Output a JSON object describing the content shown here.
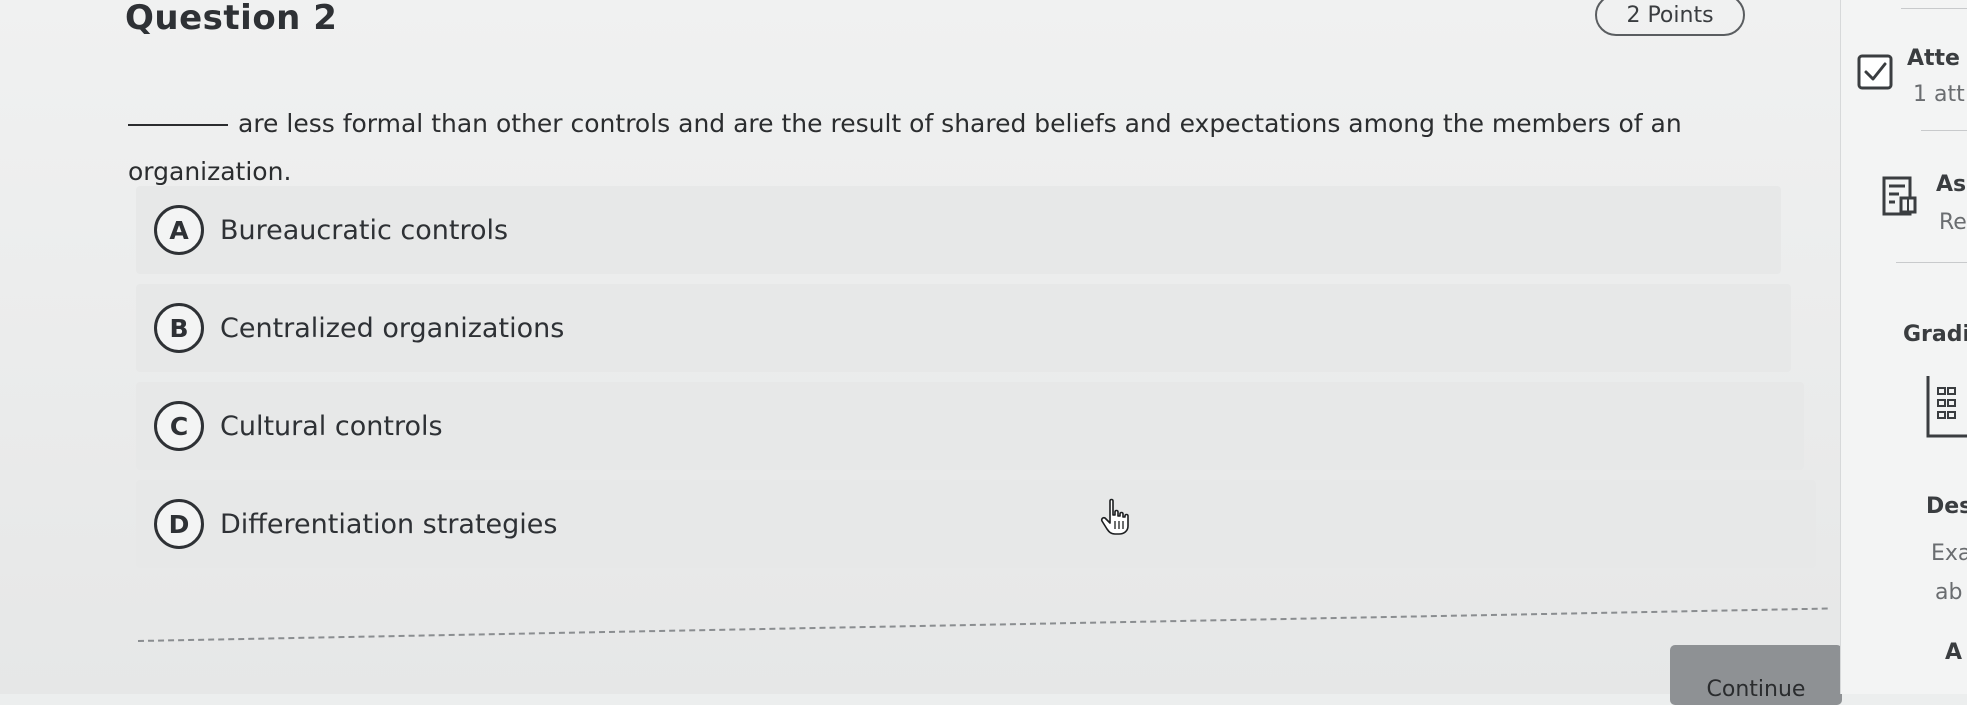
{
  "question": {
    "title": "Question 2",
    "points": "2 Points",
    "text": "are less formal than other controls and are the result of shared beliefs and expectations among the members of an organization."
  },
  "options": [
    {
      "letter": "A",
      "label": "Bureaucratic controls"
    },
    {
      "letter": "B",
      "label": "Centralized organizations"
    },
    {
      "letter": "C",
      "label": "Cultural controls"
    },
    {
      "letter": "D",
      "label": "Differentiation strategies"
    }
  ],
  "footer": {
    "continue_label": "Continue"
  },
  "sidebar": {
    "attempts_title": "Atte",
    "attempts_value": "1 att",
    "assessment_title": "Ass",
    "assessment_sub": "Re",
    "grading_title": "Gradi",
    "description_title": "Des",
    "description_line1": "Exa",
    "description_line2": "ab",
    "description_line3": "A"
  },
  "icons": {
    "attempts": "checkbox-checked-icon",
    "assessment": "document-list-icon",
    "grading": "gradebook-icon",
    "cursor": "hand-pointer-icon"
  },
  "colors": {
    "page_background": "#eceeee",
    "option_background": "#e7e8e8",
    "continue_button": "#8e9194",
    "text": "#2b2d2f"
  }
}
